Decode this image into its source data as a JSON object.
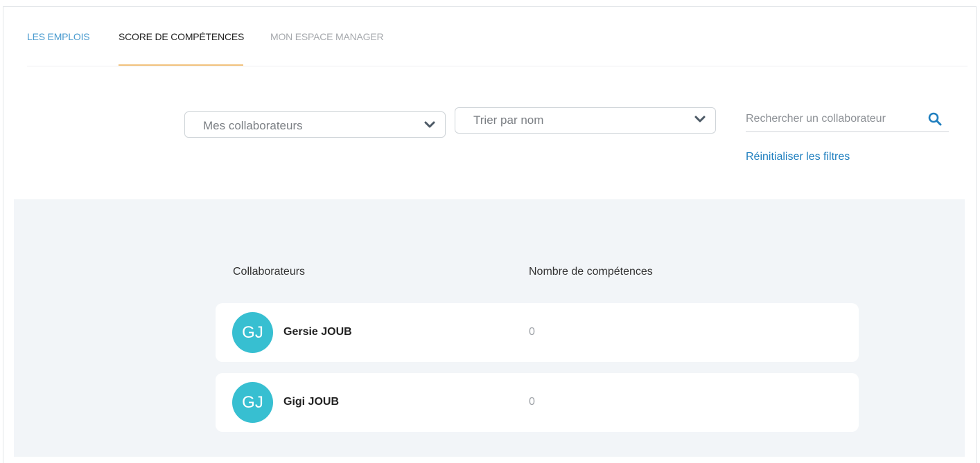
{
  "tabs": [
    {
      "label": "LES EMPLOIS"
    },
    {
      "label": "SCORE DE COMPÉTENCES"
    },
    {
      "label": "MON ESPACE MANAGER"
    }
  ],
  "filters": {
    "collaborators_select": "Mes collaborateurs",
    "sort_select": "Trier par nom",
    "search_placeholder": "Rechercher un collaborateur",
    "reset_label": "Réinitialiser les filtres"
  },
  "table": {
    "headers": [
      "Collaborateurs",
      "Nombre de compétences"
    ],
    "rows": [
      {
        "initials": "GJ",
        "name": "Gersie JOUB",
        "count": "0"
      },
      {
        "initials": "GJ",
        "name": "Gigi JOUB",
        "count": "0"
      }
    ]
  },
  "colors": {
    "active_tab_underline": "#f1c27d",
    "link": "#1f7fbf",
    "avatar": "#37bfd1",
    "panel_bg": "#f2f5f8"
  },
  "icons": [
    "chevron-down-icon",
    "search-icon"
  ]
}
